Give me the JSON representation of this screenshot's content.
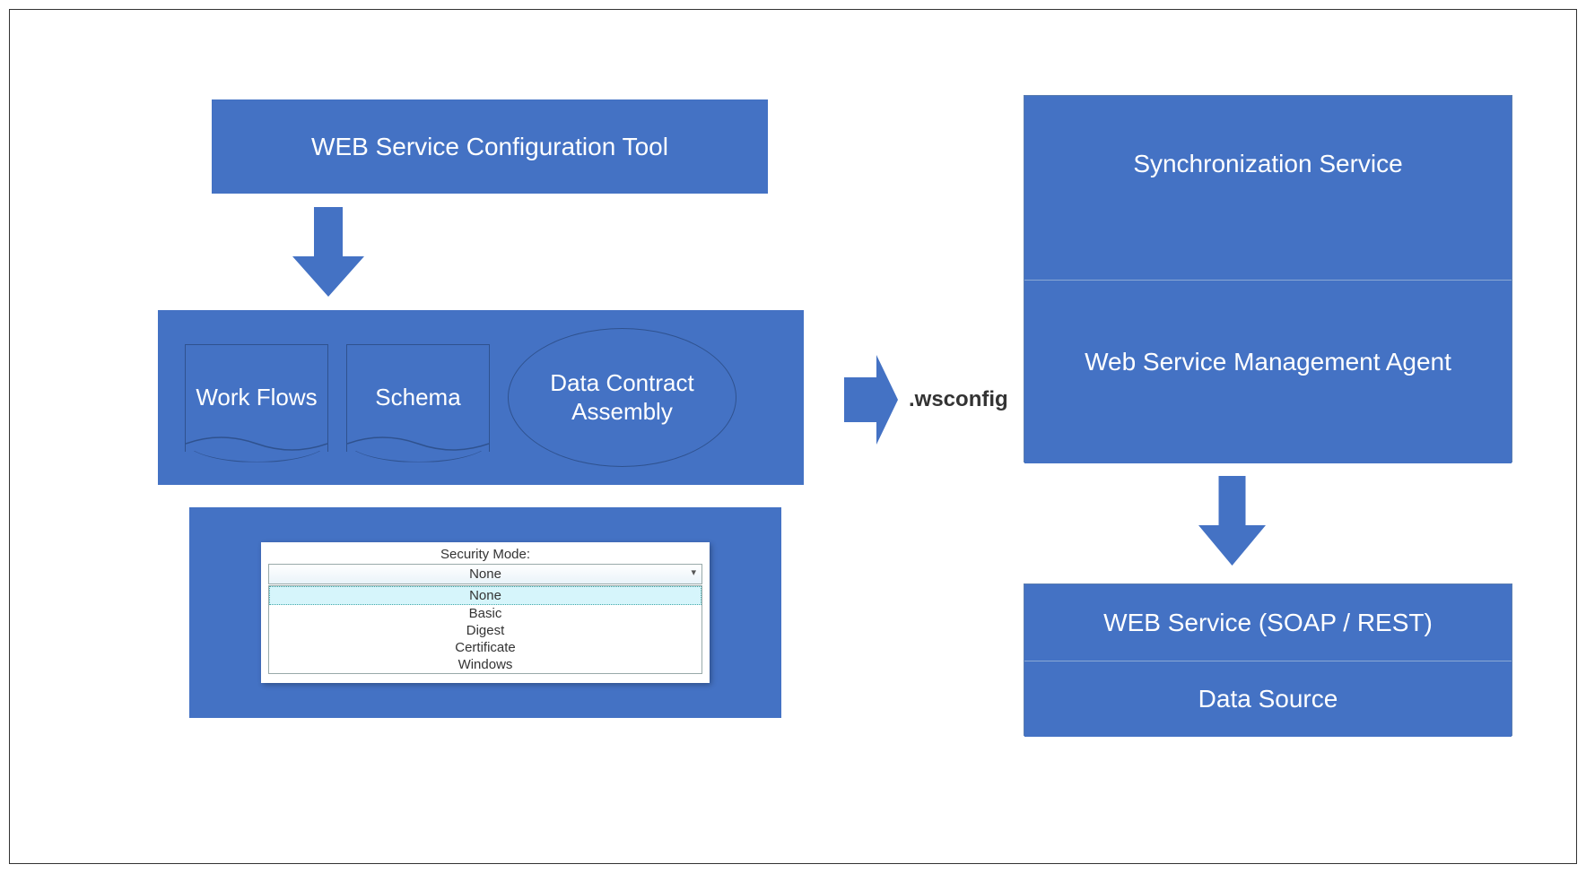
{
  "config_tool": {
    "title": "WEB Service Configuration Tool"
  },
  "workflow_container": {
    "workflows_label": "Work Flows",
    "schema_label": "Schema",
    "assembly_label": "Data Contract Assembly"
  },
  "security": {
    "label": "Security Mode:",
    "selected": "None",
    "options": [
      "None",
      "Basic",
      "Digest",
      "Certificate",
      "Windows"
    ]
  },
  "arrow_label": ".wsconfig",
  "right_top": {
    "sync_service": "Synchronization Service",
    "management_agent": "Web Service Management Agent"
  },
  "right_bottom": {
    "web_service": "WEB Service (SOAP / REST)",
    "data_source": "Data Source"
  }
}
